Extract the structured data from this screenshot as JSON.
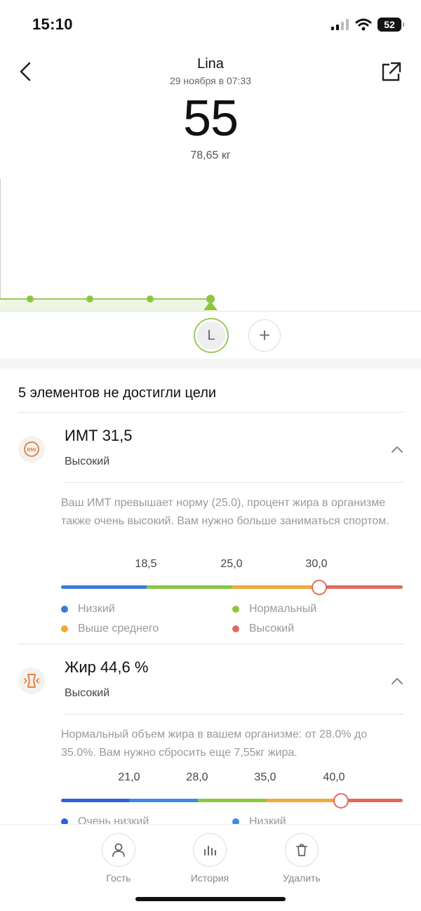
{
  "status_bar": {
    "time": "15:10",
    "battery": "52"
  },
  "header": {
    "name": "Lina",
    "date": "29 ноября в 07:33",
    "value": "55",
    "weight": "78,65 кг"
  },
  "users": {
    "current_initial": "L",
    "add_symbol": "+"
  },
  "section": {
    "title": "5 элементов не достигли цели"
  },
  "metrics": [
    {
      "title": "ИМТ 31,5",
      "status": "Высокий",
      "icon_text": "BMI",
      "description": "Ваш ИМТ превышает норму (25.0), процент жира в организме также очень высокий. Вам нужно больше заниматься спортом.",
      "ticks": [
        "18,5",
        "25,0",
        "30,0"
      ],
      "marker_fraction": 0.755,
      "segments": [
        "#3b7be0",
        "#8cc63f",
        "#f0a93a",
        "#e06b5b"
      ],
      "legend": [
        "Низкий",
        "Нормальный",
        "Выше среднего",
        "Высокий"
      ]
    },
    {
      "title": "Жир 44,6 %",
      "status": "Высокий",
      "description": "Нормальный объем жира в вашем организме: от 28.0% до 35.0%. Вам нужно сбросить еще 7,55кг жира.",
      "ticks": [
        "21,0",
        "28,0",
        "35,0",
        "40,0"
      ],
      "marker_fraction": 0.82,
      "segments": [
        "#2f5ee0",
        "#3b8ae8",
        "#8cc63f",
        "#f0a93a",
        "#e06b5b"
      ],
      "legend": [
        "Очень низкий",
        "Низкий"
      ]
    }
  ],
  "bottom_nav": [
    {
      "label": "Гость",
      "icon": "person-icon"
    },
    {
      "label": "История",
      "icon": "bar-chart-icon"
    },
    {
      "label": "Удалить",
      "icon": "trash-icon"
    }
  ],
  "colors": {
    "accent_green": "#9acb5a",
    "orange": "#e8843c",
    "red": "#e06b5b",
    "blue": "#3b7be0",
    "yellow": "#f0a93a"
  }
}
